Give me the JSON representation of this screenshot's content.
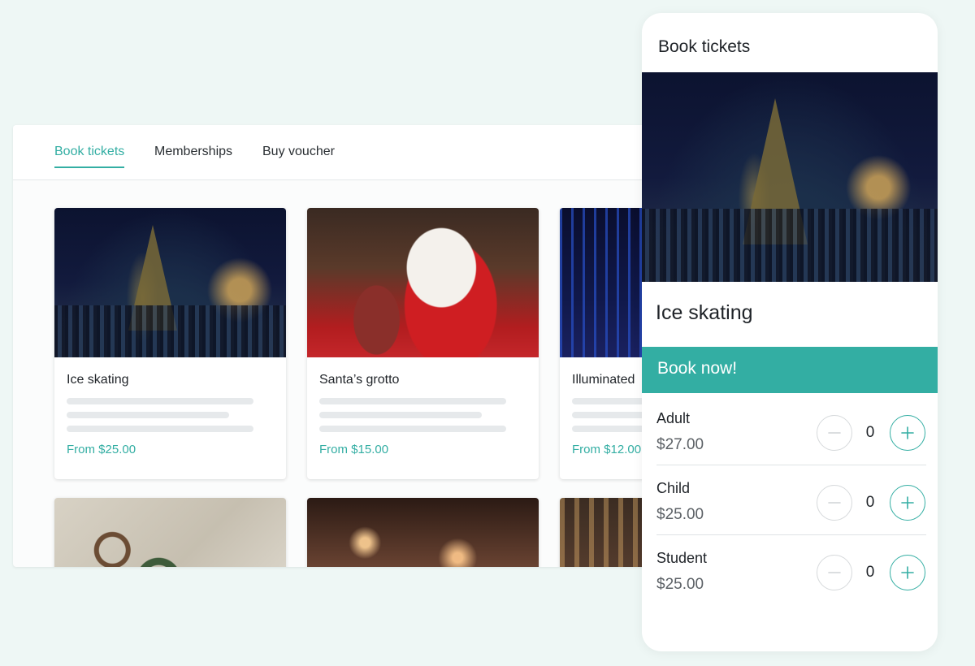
{
  "app": {
    "tabs": [
      {
        "label": "Book tickets",
        "active": true
      },
      {
        "label": "Memberships",
        "active": false
      },
      {
        "label": "Buy voucher",
        "active": false
      }
    ],
    "cards": [
      {
        "title": "Ice skating",
        "price": "From $25.00",
        "image": "ice-skating-photo"
      },
      {
        "title": "Santa’s grotto",
        "price": "From $15.00",
        "image": "santa-photo"
      },
      {
        "title": "Illuminated",
        "price": "From $12.00",
        "image": "illuminated-trees-photo"
      },
      {
        "image": "wreath-photo"
      },
      {
        "image": "christmas-market-photo"
      },
      {
        "image": "town-photo"
      }
    ]
  },
  "panel": {
    "header": "Book tickets",
    "image": "ice-skating-photo",
    "title": "Ice skating",
    "book_label": "Book now!",
    "tickets": [
      {
        "label": "Adult",
        "price": "$27.00",
        "qty": "0"
      },
      {
        "label": "Child",
        "price": "$25.00",
        "qty": "0"
      },
      {
        "label": "Student",
        "price": "$25.00",
        "qty": "0"
      }
    ]
  },
  "colors": {
    "accent": "#33aea3",
    "background": "#eef7f5"
  }
}
